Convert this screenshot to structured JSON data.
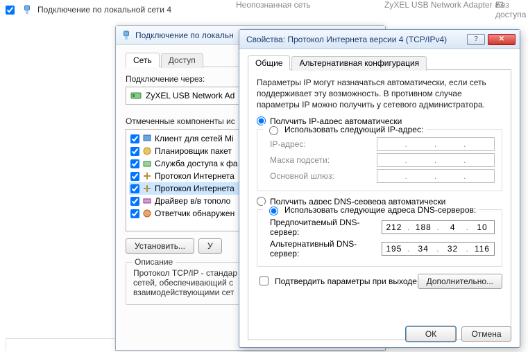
{
  "background": {
    "connection_name": "Подключение по локальной сети 4",
    "status": "Неопознанная сеть",
    "adapter": "ZyXEL USB Network Adapter #3",
    "access": "Без доступа"
  },
  "win1": {
    "title": "Подключение по локальн",
    "tabs": {
      "network": "Сеть",
      "access": "Доступ"
    },
    "connect_via": "Подключение через:",
    "adapter_name": "ZyXEL USB Network Ad",
    "components_label": "Отмеченные компоненты ис",
    "components": [
      "Клиент для сетей Mi",
      "Планировщик пакет",
      "Служба доступа к фа",
      "Протокол Интернета",
      "Протокол Интернета",
      "Драйвер в/в тополо",
      "Ответчик обнаружен"
    ],
    "buttons": {
      "install": "Установить...",
      "uninstall": "У"
    },
    "description_legend": "Описание",
    "description_text": "Протокол TCP/IP - стандар\nсетей, обеспечивающий с\nвзаимодействующими сет"
  },
  "win2": {
    "title": "Свойства: Протокол Интернета версии 4 (TCP/IPv4)",
    "help_glyph": "?",
    "close_glyph": "✕",
    "tabs": {
      "general": "Общие",
      "alt": "Альтернативная конфигурация"
    },
    "info": "Параметры IP могут назначаться автоматически, если сеть поддерживает эту возможность. В противном случае параметры IP можно получить у сетевого администратора.",
    "ip_radio_auto": "Получить IP-адрес автоматически",
    "ip_radio_manual": "Использовать следующий IP-адрес:",
    "ip_auto_selected": true,
    "ip_fields": {
      "addr_label": "IP-адрес:",
      "mask_label": "Маска подсети:",
      "gw_label": "Основной шлюз:"
    },
    "dns_radio_auto": "Получить адрес DNS-сервера автоматически",
    "dns_radio_manual": "Использовать следующие адреса DNS-серверов:",
    "dns_manual_selected": true,
    "dns_fields": {
      "pref_label": "Предпочитаемый DNS-сервер:",
      "alt_label": "Альтернативный DNS-сервер:",
      "pref_value": [
        "212",
        "188",
        "4",
        "10"
      ],
      "alt_value": [
        "195",
        "34",
        "32",
        "116"
      ]
    },
    "confirm_label": "Подтвердить параметры при выходе",
    "advanced_btn": "Дополнительно...",
    "ok_btn": "ОК",
    "cancel_btn": "Отмена"
  }
}
